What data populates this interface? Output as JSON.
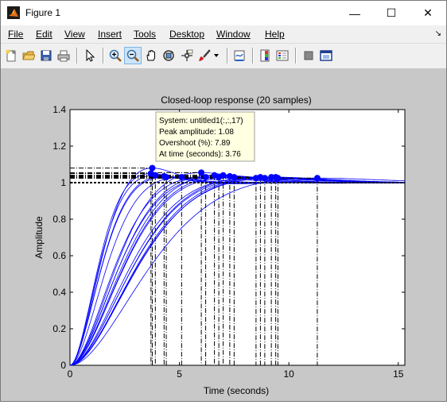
{
  "window": {
    "title": "Figure 1",
    "controls": {
      "minimize": "—",
      "maximize": "☐",
      "close": "✕"
    }
  },
  "menu": [
    "File",
    "Edit",
    "View",
    "Insert",
    "Tools",
    "Desktop",
    "Window",
    "Help"
  ],
  "toolbar_icons": [
    "new-figure-icon",
    "open-file-icon",
    "save-icon",
    "print-icon",
    "edit-plot-arrow-icon",
    "zoom-in-icon",
    "zoom-out-icon",
    "pan-hand-icon",
    "rotate-3d-icon",
    "data-cursor-icon",
    "brush-icon",
    "brush-dropdown-icon",
    "link-plot-icon",
    "insert-colorbar-icon",
    "insert-legend-icon",
    "hide-plot-tools-icon",
    "show-plot-tools-icon"
  ],
  "colors": {
    "accent": "#0000ff",
    "figure_bg": "#c8c8c8",
    "datatip_bg": "#ffffe1"
  },
  "chart_data": {
    "type": "line",
    "title": "Closed-loop response (20 samples)",
    "xlabel": "Time (seconds)",
    "ylabel": "Amplitude",
    "xlim": [
      0,
      15.3
    ],
    "ylim": [
      0,
      1.4
    ],
    "xticks": [
      "0",
      "5",
      "10",
      "15"
    ],
    "yticks": [
      "0",
      "0.2",
      "0.4",
      "0.6",
      "0.8",
      "1",
      "1.2",
      "1.4"
    ],
    "steady_state": 1.0,
    "series": [
      {
        "peak_time": 3.76,
        "peak": 1.08
      },
      {
        "peak_time": 3.7,
        "peak": 1.05
      },
      {
        "peak_time": 3.9,
        "peak": 1.04
      },
      {
        "peak_time": 4.3,
        "peak": 1.035
      },
      {
        "peak_time": 4.4,
        "peak": 1.03
      },
      {
        "peak_time": 5.1,
        "peak": 1.03
      },
      {
        "peak_time": 6.0,
        "peak": 1.055
      },
      {
        "peak_time": 6.2,
        "peak": 1.03
      },
      {
        "peak_time": 6.6,
        "peak": 1.04
      },
      {
        "peak_time": 6.8,
        "peak": 1.03
      },
      {
        "peak_time": 7.0,
        "peak": 1.04
      },
      {
        "peak_time": 7.3,
        "peak": 1.035
      },
      {
        "peak_time": 7.5,
        "peak": 1.03
      },
      {
        "peak_time": 8.5,
        "peak": 1.025
      },
      {
        "peak_time": 8.7,
        "peak": 1.03
      },
      {
        "peak_time": 8.9,
        "peak": 1.025
      },
      {
        "peak_time": 9.2,
        "peak": 1.03
      },
      {
        "peak_time": 9.4,
        "peak": 1.03
      },
      {
        "peak_time": 9.5,
        "peak": 1.025
      },
      {
        "peak_time": 11.3,
        "peak": 1.025
      }
    ],
    "datatip": {
      "lines": [
        "System: untitled1(:,:,17)",
        "Peak amplitude: 1.08",
        "Overshoot (%): 7.89",
        "At time (seconds): 3.76"
      ]
    }
  }
}
